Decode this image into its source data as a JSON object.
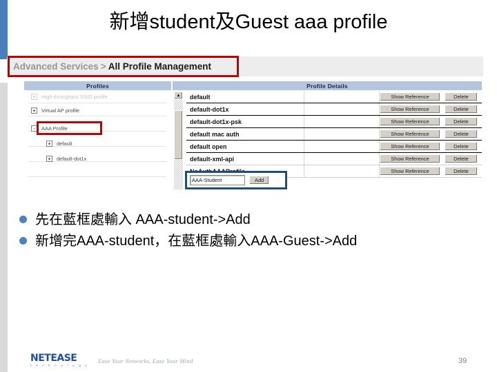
{
  "slide": {
    "title": "新增student及Guest aaa profile",
    "page_number": "39"
  },
  "breadcrumb": {
    "parent": "Advanced Services",
    "separator": ">",
    "current": "All Profile Management",
    "highlight_color": "#c00000"
  },
  "screenshot": {
    "panel_headers": {
      "left": "Profiles",
      "right": "Profile Details"
    },
    "tree": {
      "items": [
        {
          "label": "High-throughput SSID profile",
          "toggle": "+",
          "indent": 0,
          "faded": true
        },
        {
          "label": "Virtual AP profile",
          "toggle": "+",
          "indent": 0,
          "faded": false
        },
        {
          "label": "AAA Profile",
          "toggle": "-",
          "indent": 0,
          "faded": false,
          "highlighted": true
        },
        {
          "label": "default",
          "toggle": "+",
          "indent": 1,
          "faded": false
        },
        {
          "label": "default-dot1x",
          "toggle": "+",
          "indent": 1,
          "faded": false
        }
      ],
      "highlight_color": "#c00000"
    },
    "scrollbar": {
      "up_arrow": "▲"
    },
    "table": {
      "action_labels": {
        "show_reference": "Show Reference",
        "delete": "Delete"
      },
      "rows": [
        {
          "name": "default"
        },
        {
          "name": "default-dot1x"
        },
        {
          "name": "default-dot1x-psk"
        },
        {
          "name": "default mac auth"
        },
        {
          "name": "default open"
        },
        {
          "name": "default-xml-api"
        },
        {
          "name": "NoAuthAAAProfile"
        }
      ]
    },
    "add_row": {
      "input_value": "AAA-Student",
      "add_label": "Add",
      "highlight_color": "#1f4e79"
    }
  },
  "bullets": [
    {
      "text": "先在藍框處輸入 AAA-student->Add"
    },
    {
      "text": "新增完AAA-student，在藍框處輸入AAA-Guest->Add"
    }
  ],
  "footer": {
    "logo_word": "NETEASE",
    "logo_sub": "t e c h n o l o g y",
    "tagline": "Ease Your Networks, Ease Your Mind"
  }
}
